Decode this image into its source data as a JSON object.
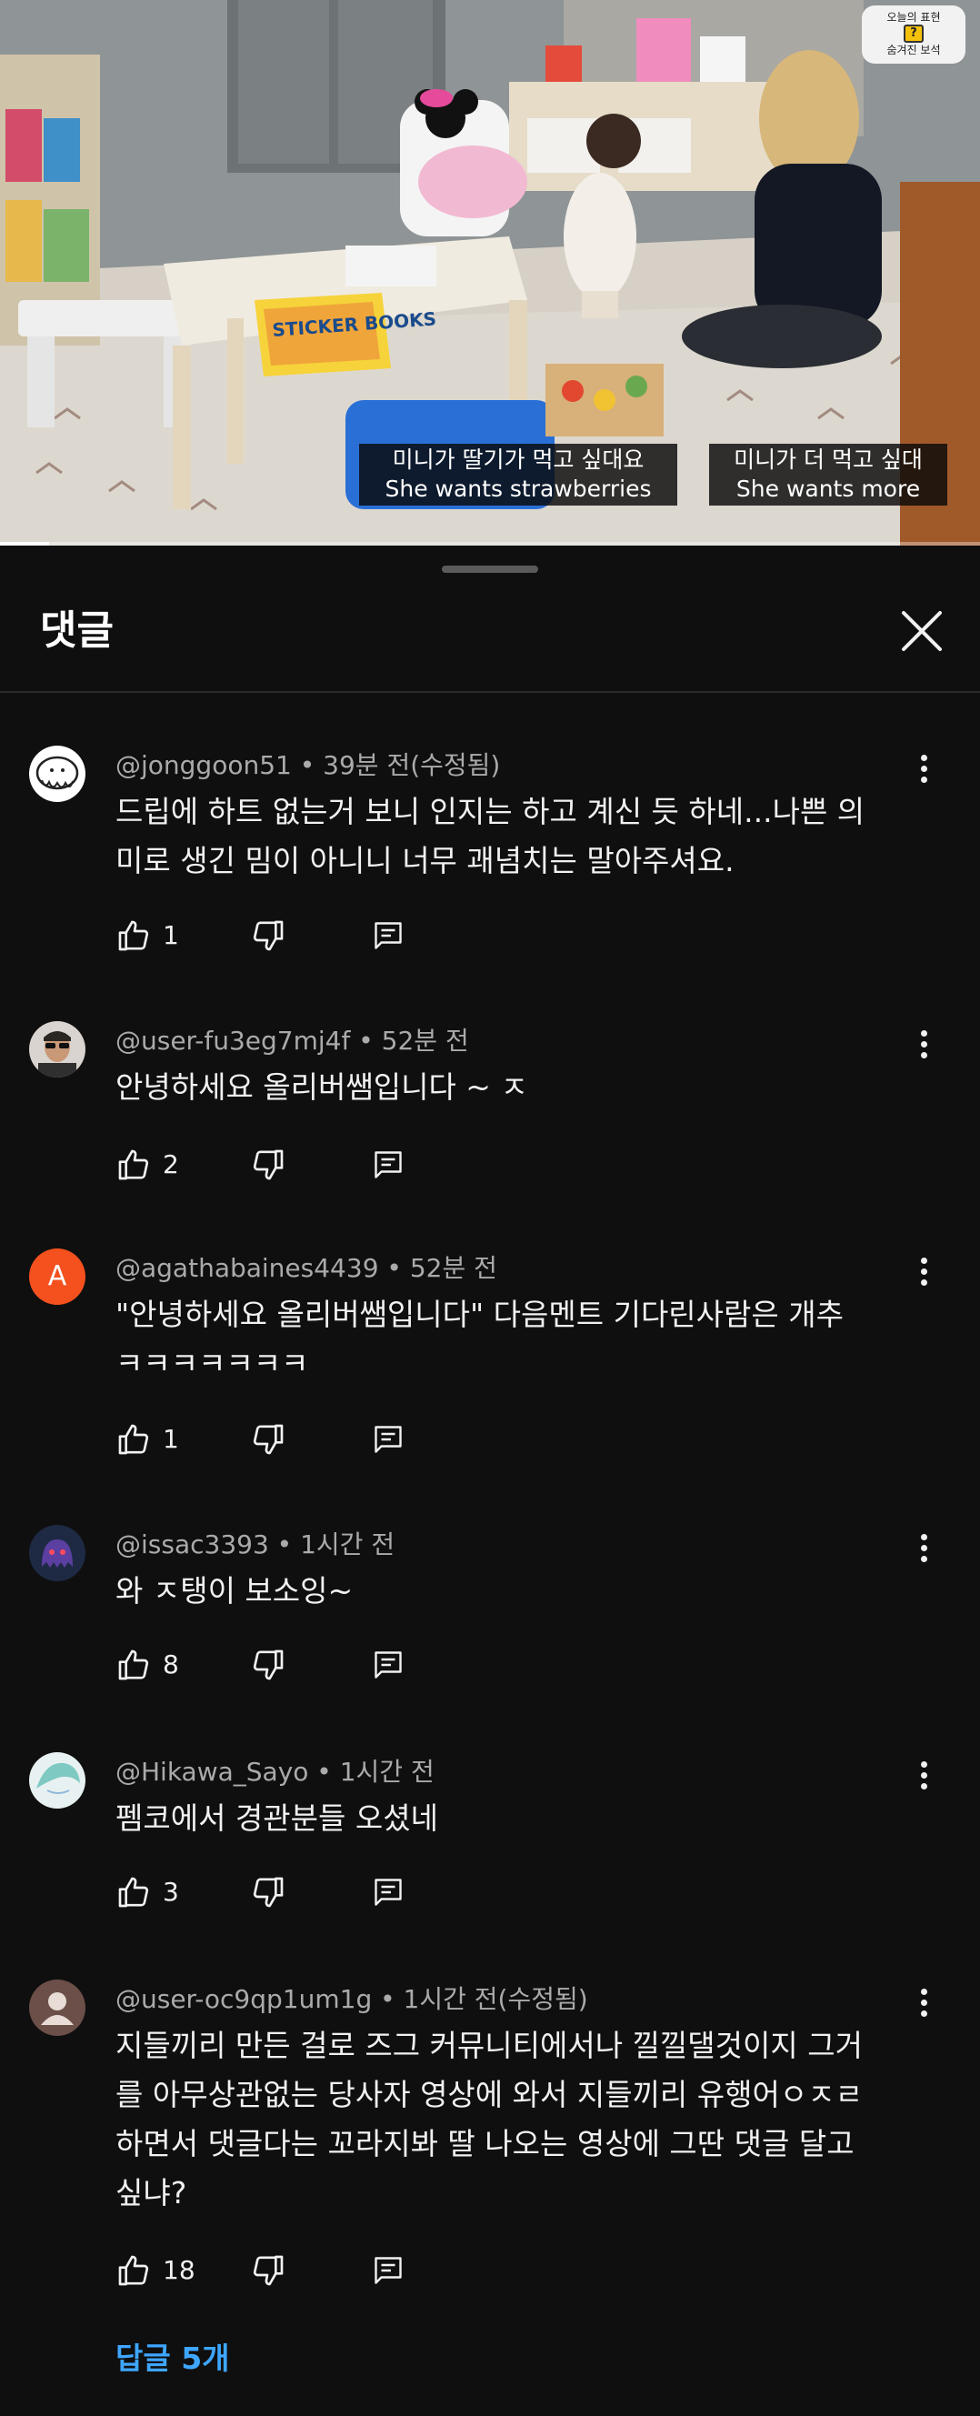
{
  "video": {
    "badge": {
      "line1": "오늘의 표현",
      "icon_glyph": "?",
      "line2": "숨겨진 보석"
    },
    "subtitle_left": {
      "ko": "미니가 딸기가 먹고 싶대요",
      "en": "She wants strawberries"
    },
    "subtitle_right": {
      "ko": "미니가 더 먹고 싶대",
      "en": "She wants more"
    },
    "book_title": "STICKER BOOKS",
    "progress_fraction": 0.05
  },
  "sheet": {
    "title": "댓글",
    "close_icon": "close-icon"
  },
  "comments": [
    {
      "author": "@jonggoon51",
      "time": "39분 전(수정됨)",
      "text_lines": [
        "드립에 하트 없는거 보니 인지는 하고 계신 듯 하네...나쁜 의",
        "미로 생긴 밈이 아니니 너무 괘념치는 말아주셔요."
      ],
      "likes": "1",
      "avatar": "doodle"
    },
    {
      "author": "@user-fu3eg7mj4f",
      "time": "52분 전",
      "text_lines": [
        "안녕하세요 올리버쌤입니다 ~ ㅈ"
      ],
      "likes": "2",
      "avatar": "photo-sunglasses"
    },
    {
      "author": "@agathabaines4439",
      "time": "52분 전",
      "text_lines": [
        "\"안녕하세요 올리버쌤입니다\" 다음멘트 기다린사람은 개추",
        "ㅋㅋㅋㅋㅋㅋㅋ"
      ],
      "likes": "1",
      "avatar": "letter",
      "avatar_letter": "A",
      "avatar_color": "#f4511e"
    },
    {
      "author": "@issac3393",
      "time": "1시간 전",
      "text_lines": [
        "와 ㅈ탱이 보소잉~"
      ],
      "likes": "8",
      "avatar": "ghost-purple"
    },
    {
      "author": "@Hikawa_Sayo",
      "time": "1시간 전",
      "text_lines": [
        "펨코에서 경관분들 오셨네"
      ],
      "likes": "3",
      "avatar": "anime-teal"
    },
    {
      "author": "@user-oc9qp1um1g",
      "time": "1시간 전(수정됨)",
      "text_lines": [
        "지들끼리 만든 걸로 즈그 커뮤니티에서나 낄낄댈것이지 그거",
        "를 아무상관없는 당사자 영상에 와서 지들끼리 유행어ㅇㅈㄹ",
        "하면서 댓글다는 꼬라지봐 딸 나오는 영상에 그딴 댓글 달고",
        "싶냐?"
      ],
      "likes": "18",
      "avatar": "default-user"
    }
  ],
  "replies_link": "답글 5개",
  "icons": {
    "like": "thumbs-up-icon",
    "dislike": "thumbs-down-icon",
    "reply": "reply-icon",
    "more": "more-vert-icon"
  },
  "colors": {
    "background": "#0f0f0f",
    "text": "#f1f1f1",
    "meta": "#aaaaaa",
    "link": "#3ea6ff"
  }
}
